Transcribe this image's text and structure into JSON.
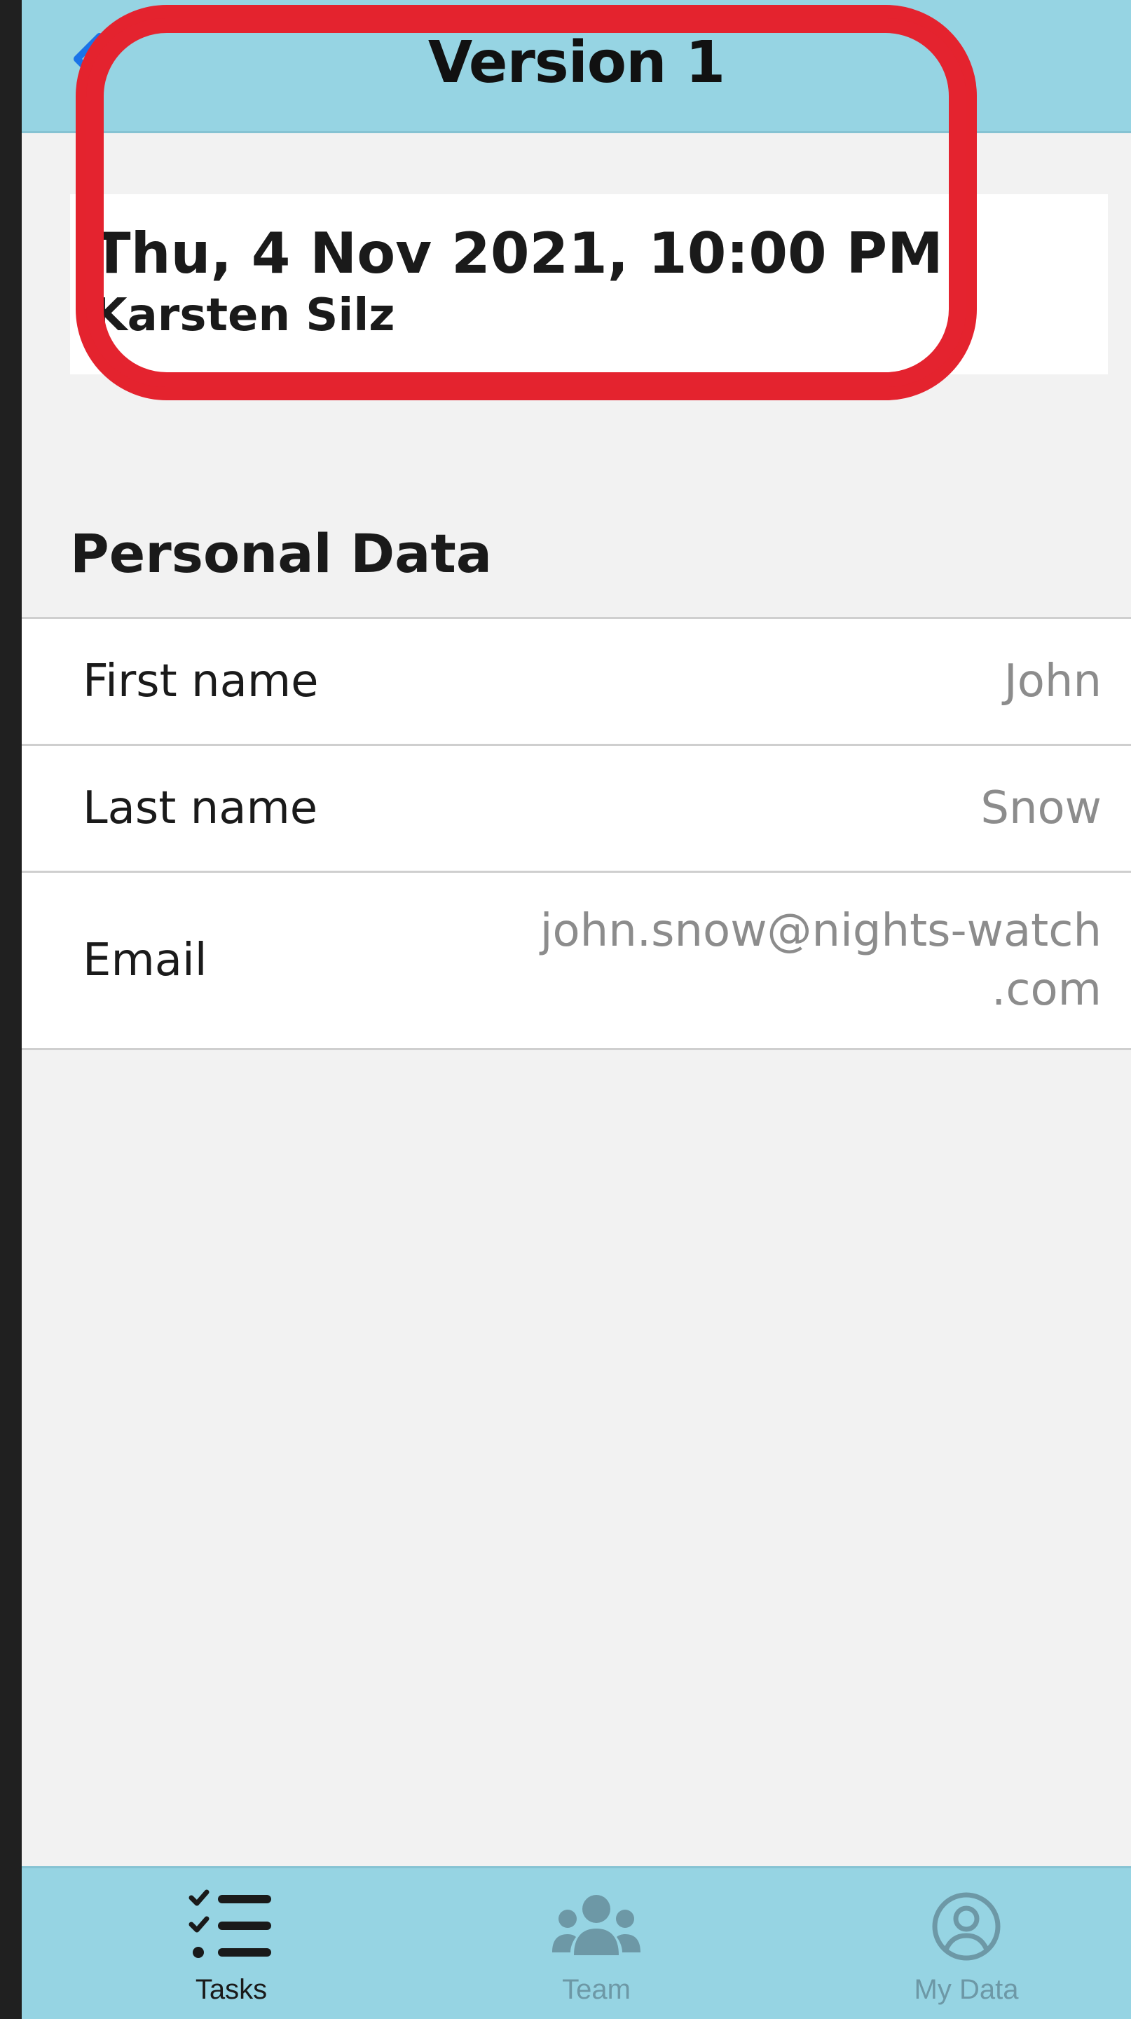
{
  "navbar": {
    "title": "Version 1",
    "back_icon": "chevron-left-icon",
    "back_color": "#1a73e8"
  },
  "version": {
    "date": "Thu, 4 Nov 2021, 10:00 PM",
    "author": "Karsten Silz"
  },
  "annotation": {
    "color": "#e4232f"
  },
  "personal_data": {
    "heading": "Personal Data",
    "rows": [
      {
        "label": "First name",
        "value_lines": [
          "John"
        ]
      },
      {
        "label": "Last name",
        "value_lines": [
          "Snow"
        ]
      },
      {
        "label": "Email",
        "value_lines": [
          "john.snow@nights-watch",
          ".com"
        ]
      }
    ]
  },
  "tabbar": {
    "tabs": [
      {
        "label": "Tasks",
        "icon": "checklist-icon",
        "active": true
      },
      {
        "label": "Team",
        "icon": "team-icon",
        "active": false
      },
      {
        "label": "My Data",
        "icon": "user-circle-icon",
        "active": false
      }
    ],
    "active_color": "#1a1a1a",
    "inactive_color": "#6d98a6"
  },
  "colors": {
    "bar_background": "#96d4e3",
    "page_background": "#f2f2f2"
  }
}
